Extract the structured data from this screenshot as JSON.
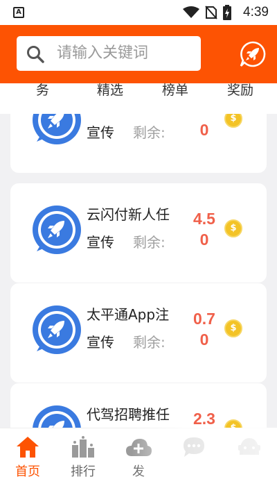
{
  "status_bar": {
    "time": "4:39",
    "notification_icon": "A"
  },
  "search": {
    "placeholder": "请输入关键词"
  },
  "tabs": [
    {
      "label": "务"
    },
    {
      "label": "精选"
    },
    {
      "label": "榜单"
    },
    {
      "label": "奖励"
    }
  ],
  "tasks": [
    {
      "title": "",
      "tag": "宣传",
      "remaining_label": "剩余:",
      "reward_line1": "",
      "reward_line2": "0",
      "coin": "$"
    },
    {
      "title": "云闪付新人任",
      "tag": "宣传",
      "remaining_label": "剩余:",
      "reward_line1": "4.5",
      "reward_line2": "0",
      "coin": "$"
    },
    {
      "title": "太平通App注",
      "tag": "宣传",
      "remaining_label": "剩余:",
      "reward_line1": "0.7",
      "reward_line2": "0",
      "coin": "$"
    },
    {
      "title": "代驾招聘推任",
      "tag": "",
      "remaining_label": "",
      "reward_line1": "2.3",
      "reward_line2": "",
      "coin": "$"
    }
  ],
  "bottom_nav": [
    {
      "label": "首页",
      "icon": "home-icon",
      "active": true
    },
    {
      "label": "排行",
      "icon": "ranking-icon",
      "active": false
    },
    {
      "label": "发",
      "icon": "publish-cloud-icon",
      "active": false
    },
    {
      "label": "",
      "icon": "message-icon",
      "active": false
    },
    {
      "label": "",
      "icon": "profile-icon",
      "active": false
    }
  ],
  "colors": {
    "brand": "#fd5303",
    "reward": "#f0604a",
    "coin": "#f3c326",
    "app_icon": "#3a7ae0"
  }
}
